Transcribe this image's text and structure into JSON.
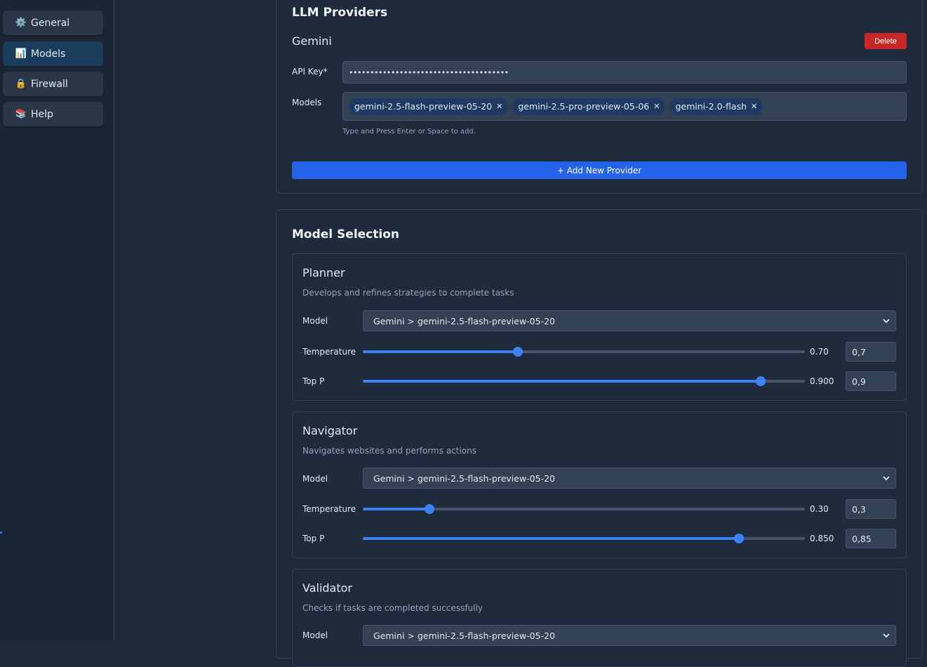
{
  "sidebar": {
    "items": [
      {
        "label": "General",
        "icon": "⚙️"
      },
      {
        "label": "Models",
        "icon": "📊"
      },
      {
        "label": "Firewall",
        "icon": "🔒"
      },
      {
        "label": "Help",
        "icon": "📚"
      }
    ],
    "active": "Models"
  },
  "providers": {
    "title": "LLM Providers",
    "name": "Gemini",
    "delete_label": "Delete",
    "api_key_label": "API Key*",
    "api_key_value": "••••••••••••••••••••••••••••••••••••••",
    "models_label": "Models",
    "models": [
      "gemini-2.5-flash-preview-05-20",
      "gemini-2.5-pro-preview-05-06",
      "gemini-2.0-flash"
    ],
    "hint": "Type and Press Enter or Space to add.",
    "add_label": "+  Add New Provider"
  },
  "selection": {
    "title": "Model Selection",
    "agents": [
      {
        "name": "Planner",
        "description": "Develops and refines strategies to complete tasks",
        "model_label": "Model",
        "model": "Gemini > gemini-2.5-flash-preview-05-20",
        "temperature_label": "Temperature",
        "temperature_display": "0.70",
        "temperature_input": "0,7",
        "temperature_fraction": 0.35,
        "top_p_label": "Top P",
        "top_p_display": "0.900",
        "top_p_input": "0,9",
        "top_p_fraction": 0.9
      },
      {
        "name": "Navigator",
        "description": "Navigates websites and performs actions",
        "model_label": "Model",
        "model": "Gemini > gemini-2.5-flash-preview-05-20",
        "temperature_label": "Temperature",
        "temperature_display": "0.30",
        "temperature_input": "0,3",
        "temperature_fraction": 0.15,
        "top_p_label": "Top P",
        "top_p_display": "0.850",
        "top_p_input": "0,85",
        "top_p_fraction": 0.85
      },
      {
        "name": "Validator",
        "description": "Checks if tasks are completed successfully",
        "model_label": "Model",
        "model": "Gemini > gemini-2.5-flash-preview-05-20"
      }
    ]
  },
  "colors": {
    "accent": "#3b82f6",
    "add_button": "#2563eb",
    "delete_button": "#c62828",
    "background": "#1e293b"
  }
}
